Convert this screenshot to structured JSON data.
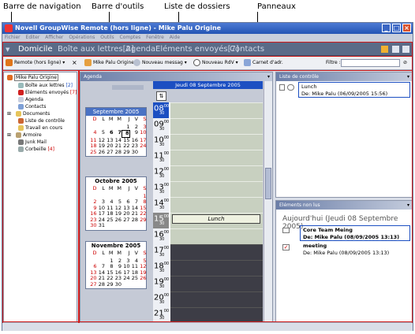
{
  "captions": {
    "nav_bar": "Barre de navigation",
    "toolbar": "Barre d'outils",
    "folder_list": "Liste de dossiers",
    "panels": "Panneaux"
  },
  "window": {
    "title": "Novell GroupWise Remote (hors ligne) - Mike Palu Origine"
  },
  "menu": [
    "Fichier",
    "Editer",
    "Afficher",
    "Opérations",
    "Outils",
    "Comptes",
    "Fenêtre",
    "Aide"
  ],
  "tabs": [
    "Domicile",
    "Boîte aux lettres[2]",
    "Agenda",
    "Eléments envoyés[7]",
    "Contacts"
  ],
  "toolbar": {
    "mode": "Remote (hors ligne)",
    "owner": "Mike Palu Origine",
    "new_message": "Nouveau messag",
    "new_appt": "Nouveau RdV",
    "address_book": "Carnet d'adr.",
    "filter_label": "Filtre :"
  },
  "folders": [
    {
      "label": "Mike Palu Origine",
      "count": ""
    },
    {
      "label": "Boîte aux lettres",
      "count": "[2]"
    },
    {
      "label": "Eléments envoyés",
      "count": "[7]"
    },
    {
      "label": "Agenda",
      "count": ""
    },
    {
      "label": "Contacts",
      "count": ""
    },
    {
      "label": "Documents",
      "count": ""
    },
    {
      "label": "Liste de contrôle",
      "count": ""
    },
    {
      "label": "Travail en cours",
      "count": ""
    },
    {
      "label": "Armoire",
      "count": ""
    },
    {
      "label": "Junk Mail",
      "count": ""
    },
    {
      "label": "Corbeille",
      "count": "[4]"
    }
  ],
  "agenda": {
    "title": "Agenda",
    "day_header": "Jeudi 08 Septembre 2005",
    "event": "Lunch",
    "hours": [
      "08",
      "09",
      "10",
      "11",
      "12",
      "13",
      "14",
      "15",
      "16",
      "17",
      "18",
      "19",
      "20",
      "21"
    ],
    "minutes": "00",
    "half": "30"
  },
  "weekdays": [
    "D",
    "L",
    "M",
    "M",
    "J",
    "V",
    "S"
  ],
  "calendars": [
    {
      "month": "Septembre 2005",
      "days": [
        "",
        "",
        "",
        "",
        "1",
        "2",
        "3",
        "4",
        "5",
        "6",
        "7",
        "8",
        "9",
        "10",
        "11",
        "12",
        "13",
        "14",
        "15",
        "16",
        "17",
        "18",
        "19",
        "20",
        "21",
        "22",
        "23",
        "24",
        "25",
        "26",
        "27",
        "28",
        "29",
        "30",
        ""
      ]
    },
    {
      "month": "Octobre 2005",
      "days": [
        "",
        "",
        "",
        "",
        "",
        "",
        "1",
        "2",
        "3",
        "4",
        "5",
        "6",
        "7",
        "8",
        "9",
        "10",
        "11",
        "12",
        "13",
        "14",
        "15",
        "16",
        "17",
        "18",
        "19",
        "20",
        "21",
        "22",
        "23",
        "24",
        "25",
        "26",
        "27",
        "28",
        "29",
        "30",
        "31"
      ]
    },
    {
      "month": "Novembre 2005",
      "days": [
        "",
        "",
        "1",
        "2",
        "3",
        "4",
        "5",
        "6",
        "7",
        "8",
        "9",
        "10",
        "11",
        "12",
        "13",
        "14",
        "15",
        "16",
        "17",
        "18",
        "19",
        "20",
        "21",
        "22",
        "23",
        "24",
        "25",
        "26",
        "27",
        "28",
        "29",
        "30"
      ]
    }
  ],
  "checklist": {
    "title": "Liste de contrôle",
    "item": "Lunch",
    "from": "De: Mike Palu (06/09/2005 15:56)"
  },
  "unread": {
    "title": "Eléments non lus",
    "date": "Aujourd'hui (Jeudi 08 Septembre 2005)",
    "items": [
      {
        "subject": "Core Team Meing",
        "from": "De: Mike Palu (08/09/2005 13:13)"
      },
      {
        "subject": "meeting",
        "from": "De: Mike Palu (08/09/2005 13:13)"
      }
    ]
  }
}
